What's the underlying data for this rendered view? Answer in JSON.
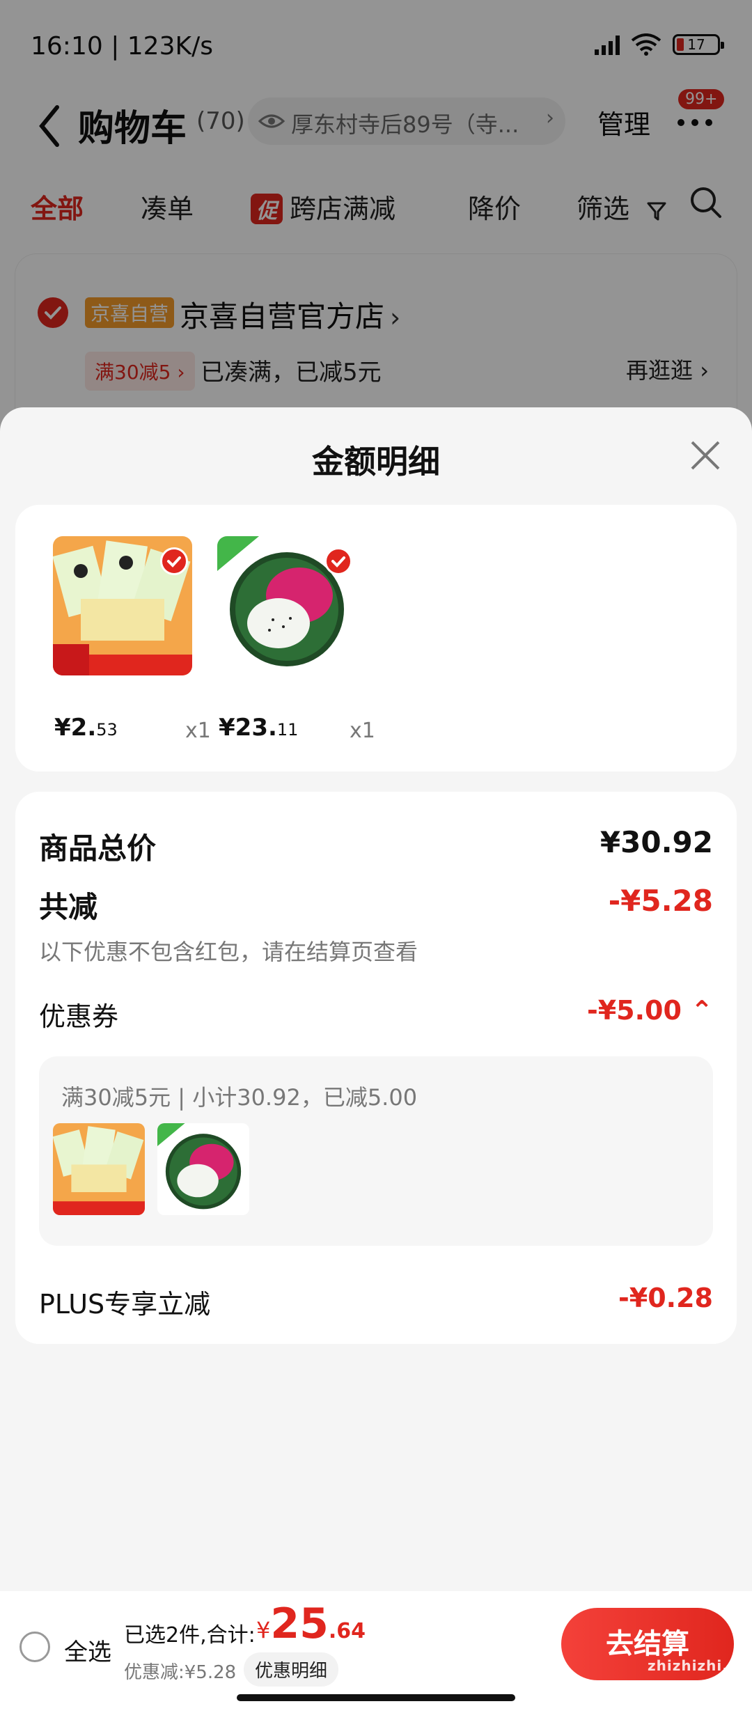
{
  "status_bar": {
    "time": "16:10 | 123K/s",
    "battery": "17"
  },
  "nav": {
    "title": "购物车",
    "count": "(70)",
    "address": "厚东村寺后89号（寺...",
    "manage": "管理",
    "badge": "99+"
  },
  "tabs": [
    {
      "label": "全部"
    },
    {
      "label": "凑单"
    },
    {
      "tag": "促",
      "label": "跨店满减"
    },
    {
      "label": "降价"
    },
    {
      "label": "筛选"
    }
  ],
  "store": {
    "tag": "京喜自营",
    "name": "京喜自营官方店",
    "promo_chip": "满30减5 ›",
    "promo_text": "已凑满，已减5元",
    "more": "再逛逛 ›"
  },
  "sheet": {
    "title": "金额明细",
    "items": [
      {
        "price_int": "¥2.",
        "price_dec": "53",
        "qty": "x1",
        "name": "bamboo-shoot-snack"
      },
      {
        "price_int": "¥23.",
        "price_dec": "11",
        "qty": "x1",
        "name": "dragon-fruit"
      }
    ],
    "summary": {
      "total_label": "商品总价",
      "total_value": "¥30.92",
      "reduce_label": "共减",
      "reduce_value": "-¥5.28",
      "note": "以下优惠不包含红包，请在结算页查看",
      "coupon_label": "优惠券",
      "coupon_value": "-¥5.00 ⌃",
      "coupon_desc": "满30减5元 | 小计30.92，已减5.00",
      "plus_label": "PLUS专享立减",
      "plus_value": "-¥0.28"
    }
  },
  "bottom": {
    "select_all": "全选",
    "selected": "已选2件,合计:",
    "yen": "¥",
    "total_big": "25",
    "total_small": ".64",
    "discount": "优惠减:¥5.28",
    "detail": "优惠明细",
    "checkout": "去结算"
  },
  "watermark": "zhizhizhi.com",
  "colors": {
    "accent": "#e0261e",
    "store_tag": "#f59b2a"
  }
}
